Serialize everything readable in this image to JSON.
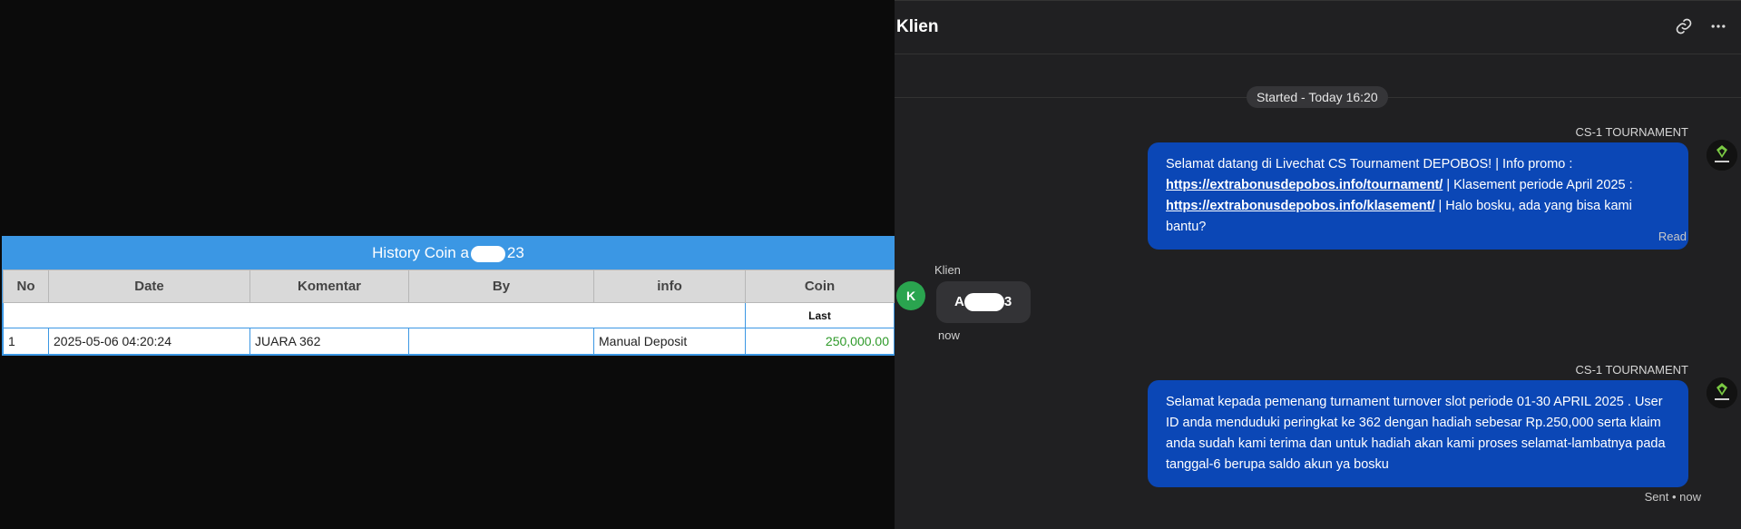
{
  "history": {
    "title_prefix": "History Coin a",
    "title_suffix": "23",
    "columns": [
      "No",
      "Date",
      "Komentar",
      "By",
      "info",
      "Coin"
    ],
    "subheader_last": "Last",
    "rows": [
      {
        "no": "1",
        "date": "2025-05-06 04:20:24",
        "komentar": "JUARA 362",
        "by": "",
        "info": "Manual Deposit",
        "coin": "250,000.00"
      }
    ]
  },
  "chat": {
    "header_title": "Klien",
    "header_icons": [
      "link-icon",
      "more-icon"
    ],
    "started_label": "Started - Today 16:20",
    "messages": [
      {
        "sender": "CS-1 TOURNAMENT",
        "text1": "Selamat datang di Livechat CS Tournament DEPOBOS! | Info promo :",
        "link1": "https://extrabonusdepobos.info/tournament/",
        "text2": " | Klasement periode April 2025 :",
        "link2": "https://extrabonusdepobos.info/klasement/",
        "text3": " | Halo bosku, ada yang bisa kami bantu?",
        "status": "Read"
      },
      {
        "client_name": "Klien",
        "avatar_letter": "K",
        "text_prefix": "A",
        "text_suffix": "3",
        "time": "now"
      },
      {
        "sender": "CS-1 TOURNAMENT",
        "text": "Selamat kepada pemenang turnament turnover slot periode 01-30 APRIL 2025 . User ID anda menduduki peringkat ke 362 dengan hadiah sebesar Rp.250,000 serta klaim anda sudah kami terima dan untuk hadiah akan kami proses selamat-lambatnya pada tanggal-6 berupa saldo akun ya bosku",
        "status": "Sent • now"
      }
    ]
  },
  "colors": {
    "table_header": "#3b97e4",
    "agent_bubble": "#0b47b6",
    "client_avatar": "#2aa44f",
    "chat_bg": "#202022",
    "coin_text": "#2f9a2a"
  }
}
